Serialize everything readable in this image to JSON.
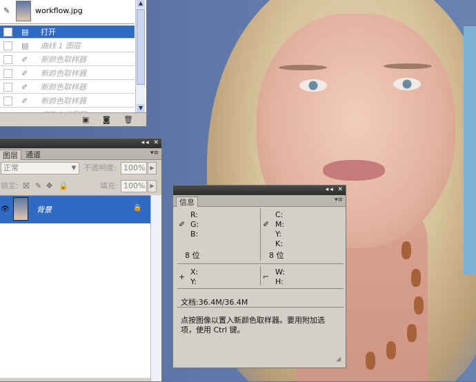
{
  "history": {
    "snapshot_label": "workflow.jpg",
    "items": [
      {
        "label": "打开",
        "selected": true,
        "icon": "document-icon"
      },
      {
        "label": "曲线 1 图层",
        "selected": false,
        "icon": "document-icon"
      },
      {
        "label": "新颜色取样器",
        "selected": false,
        "icon": "eyedropper-icon"
      },
      {
        "label": "新颜色取样器",
        "selected": false,
        "icon": "eyedropper-icon"
      },
      {
        "label": "新颜色取样器",
        "selected": false,
        "icon": "eyedropper-icon"
      },
      {
        "label": "新颜色取样器",
        "selected": false,
        "icon": "eyedropper-icon"
      },
      {
        "label": "修改曲线图层",
        "selected": false,
        "icon": "document-icon"
      }
    ]
  },
  "layers": {
    "tabs": [
      "图层",
      "通道"
    ],
    "blend_mode": "正常",
    "opacity_label": "不透明度:",
    "opacity_value": "100%",
    "lock_label": "锁定:",
    "fill_label": "填充:",
    "fill_value": "100%",
    "layer_name": "背景"
  },
  "info": {
    "tab": "信息",
    "left_channels": [
      "R:",
      "G:",
      "B:"
    ],
    "right_channels": [
      "C:",
      "M:",
      "Y:",
      "K:"
    ],
    "left_bits": "8 位",
    "right_bits": "8 位",
    "x_label": "X:",
    "y_label": "Y:",
    "w_label": "W:",
    "h_label": "H:",
    "doc_size": "文档:36.4M/36.4M",
    "hint": "点按图像以置入新颜色取样器。要用附加选项，使用 Ctrl 键。"
  },
  "colors": {
    "selection": "#316ac5",
    "panel": "#d4d0c8",
    "background": "#5e77a8"
  }
}
